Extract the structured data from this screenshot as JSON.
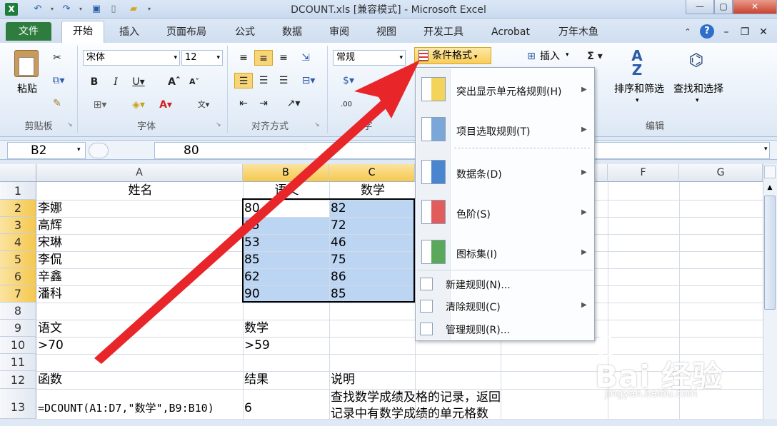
{
  "window": {
    "title": "DCOUNT.xls  [兼容模式]  -  Microsoft Excel"
  },
  "tabs": [
    "开始",
    "插入",
    "页面布局",
    "公式",
    "数据",
    "审阅",
    "视图",
    "开发工具",
    "Acrobat",
    "万年木鱼"
  ],
  "file_tab": "文件",
  "ribbon": {
    "paste": "粘贴",
    "font_name": "宋体",
    "font_size": "12",
    "number_format": "常规",
    "cond_format": "条件格式",
    "insert": "插入",
    "sort_filter": "排序和筛选",
    "find_select": "查找和选择",
    "groups": {
      "clipboard": "剪贴板",
      "font": "字体",
      "align": "对齐方式",
      "number": "字",
      "edit": "编辑"
    }
  },
  "formula_bar": {
    "cell_ref": "B2",
    "fx": "fx",
    "value": "80"
  },
  "columns": [
    "A",
    "B",
    "C",
    "D",
    "E",
    "F",
    "G"
  ],
  "rows": [
    "1",
    "2",
    "3",
    "4",
    "5",
    "6",
    "7",
    "8",
    "9",
    "10",
    "11",
    "12",
    "13"
  ],
  "cells": {
    "A1": "姓名",
    "B1": "语文",
    "C1": "数学",
    "A2": "李娜",
    "B2": "80",
    "C2": "82",
    "A3": "高辉",
    "B3": "65",
    "C3": "72",
    "A4": "宋琳",
    "B4": "53",
    "C4": "46",
    "A5": "李侃",
    "B5": "85",
    "C5": "75",
    "A6": "辛鑫",
    "B6": "62",
    "C6": "86",
    "A7": "潘科",
    "B7": "90",
    "C7": "85",
    "A9": "语文",
    "B9": "数学",
    "A10": ">70",
    "B10": ">59",
    "A12": "函数",
    "B12": "结果",
    "C12": "说明",
    "A13": "=DCOUNT(A1:D7,\"数学\",B9:B10)",
    "B13": "6",
    "C13a": "查找数学成绩及格的记录，返回",
    "C13b": "记录中有数学成绩的单元格数"
  },
  "menu": {
    "items": [
      {
        "label": "突出显示单元格规则(H)",
        "icon": "highlight-rules-icon"
      },
      {
        "label": "项目选取规则(T)",
        "icon": "top-bottom-rules-icon"
      },
      {
        "label": "数据条(D)",
        "icon": "data-bars-icon"
      },
      {
        "label": "色阶(S)",
        "icon": "color-scales-icon"
      },
      {
        "label": "图标集(I)",
        "icon": "icon-sets-icon"
      }
    ],
    "small_items": [
      {
        "label": "新建规则(N)...",
        "icon": "new-rule-icon"
      },
      {
        "label": "清除规则(C)",
        "icon": "clear-rules-icon"
      },
      {
        "label": "管理规则(R)...",
        "icon": "manage-rules-icon"
      }
    ]
  },
  "watermark": {
    "brand": "Bai 经验",
    "url": "jingyan.baidu.com"
  },
  "colors": {
    "accent_arrow": "#e8262a",
    "file_tab": "#2e7d3e",
    "selection_fill": "#bcd5f2",
    "header_selected": "#f5c84e"
  }
}
